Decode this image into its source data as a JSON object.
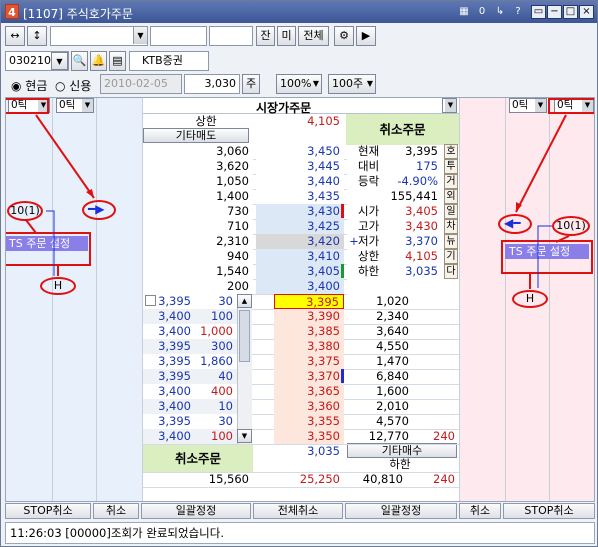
{
  "window": {
    "number": "4",
    "title": "[1107] 주식호가주문",
    "title_buttons": [
      "▦",
      "0",
      "↳",
      "?",
      "▭",
      "−",
      "□",
      "×"
    ]
  },
  "toolbar": {
    "btn_a": "↔",
    "btn_b": "↕",
    "btn_jan": "잔",
    "btn_mi": "미",
    "btn_all": "전체"
  },
  "account": {
    "code": "030210",
    "broker": "KTB증권"
  },
  "order": {
    "opt_cash": "현금",
    "opt_credit": "신용",
    "date": "2010-02-05",
    "qty": "3,030",
    "unit": "주",
    "pct": "100%",
    "shares": "100주"
  },
  "header": {
    "left_tick1": "0틱",
    "left_tick2": "0틱",
    "market_order": "시장가주문",
    "right_tick1": "0틱",
    "right_tick2": "0틱"
  },
  "top": {
    "upper_label": "상한",
    "upper_val": "4,105",
    "gita_sell": "기타매도",
    "cancel_order": "취소주문"
  },
  "sell_rows": [
    {
      "q": "3,060",
      "p": "3,450"
    },
    {
      "q": "3,620",
      "p": "3,445"
    },
    {
      "q": "1,050",
      "p": "3,440"
    },
    {
      "q": "1,400",
      "p": "3,435"
    },
    {
      "q": "730",
      "p": "3,430"
    },
    {
      "q": "710",
      "p": "3,425"
    },
    {
      "q": "2,310",
      "p": "3,420"
    },
    {
      "q": "940",
      "p": "3,410"
    },
    {
      "q": "1,540",
      "p": "3,405"
    },
    {
      "q": "200",
      "p": "3,400"
    }
  ],
  "info": [
    {
      "k": "현재",
      "v": "3,395",
      "s": "호"
    },
    {
      "k": "대비",
      "v": "175",
      "s": "투"
    },
    {
      "k": "등락",
      "v": "-4.90%",
      "s": "거"
    },
    {
      "k": "",
      "v": "155,441",
      "s": "외"
    },
    {
      "k": "시가",
      "v": "3,405",
      "s": "일"
    },
    {
      "k": "고가",
      "v": "3,430",
      "s": "차"
    },
    {
      "k": "저가",
      "v": "3,370",
      "s": "뉴"
    },
    {
      "k": "상한",
      "v": "4,105",
      "s": "기"
    },
    {
      "k": "하한",
      "v": "3,035",
      "s": "다"
    }
  ],
  "buy_rows": [
    {
      "l": "3,395",
      "r": "30",
      "p": "3,395",
      "q": "1,020"
    },
    {
      "l": "3,400",
      "r": "100",
      "p": "3,390",
      "q": "2,340"
    },
    {
      "l": "3,400",
      "r": "1,000",
      "p": "3,385",
      "q": "3,640"
    },
    {
      "l": "3,395",
      "r": "300",
      "p": "3,380",
      "q": "4,550"
    },
    {
      "l": "3,395",
      "r": "1,860",
      "p": "3,375",
      "q": "1,470"
    },
    {
      "l": "3,395",
      "r": "40",
      "p": "3,370",
      "q": "6,840"
    },
    {
      "l": "3,400",
      "r": "400",
      "p": "3,365",
      "q": "1,600"
    },
    {
      "l": "3,400",
      "r": "10",
      "p": "3,360",
      "q": "2,010"
    },
    {
      "l": "3,395",
      "r": "30",
      "p": "3,355",
      "q": "4,570"
    },
    {
      "l": "3,400",
      "r": "100",
      "p": "3,350",
      "q": "12,770",
      "x": "240"
    }
  ],
  "bottom": {
    "cancel_order": "취소주문",
    "lower_val": "3,035",
    "gita_buy": "기타매수",
    "lower_label": "하한",
    "sum_left": "15,560",
    "sum_mid": "25,250",
    "sum_q": "40,810",
    "sum_r": "240"
  },
  "annot": {
    "left_label": "10(1)",
    "left_ts": "TS 주문 설정",
    "left_h": "H",
    "right_label": "10(1)",
    "right_ts": "TS 주문 설정",
    "right_h": "H"
  },
  "footer": [
    "STOP취소",
    "취소",
    "일괄정정",
    "전체취소",
    "일괄정정",
    "취소",
    "STOP취소"
  ],
  "status": "11:26:03  [00000]조회가 완료되었습니다."
}
